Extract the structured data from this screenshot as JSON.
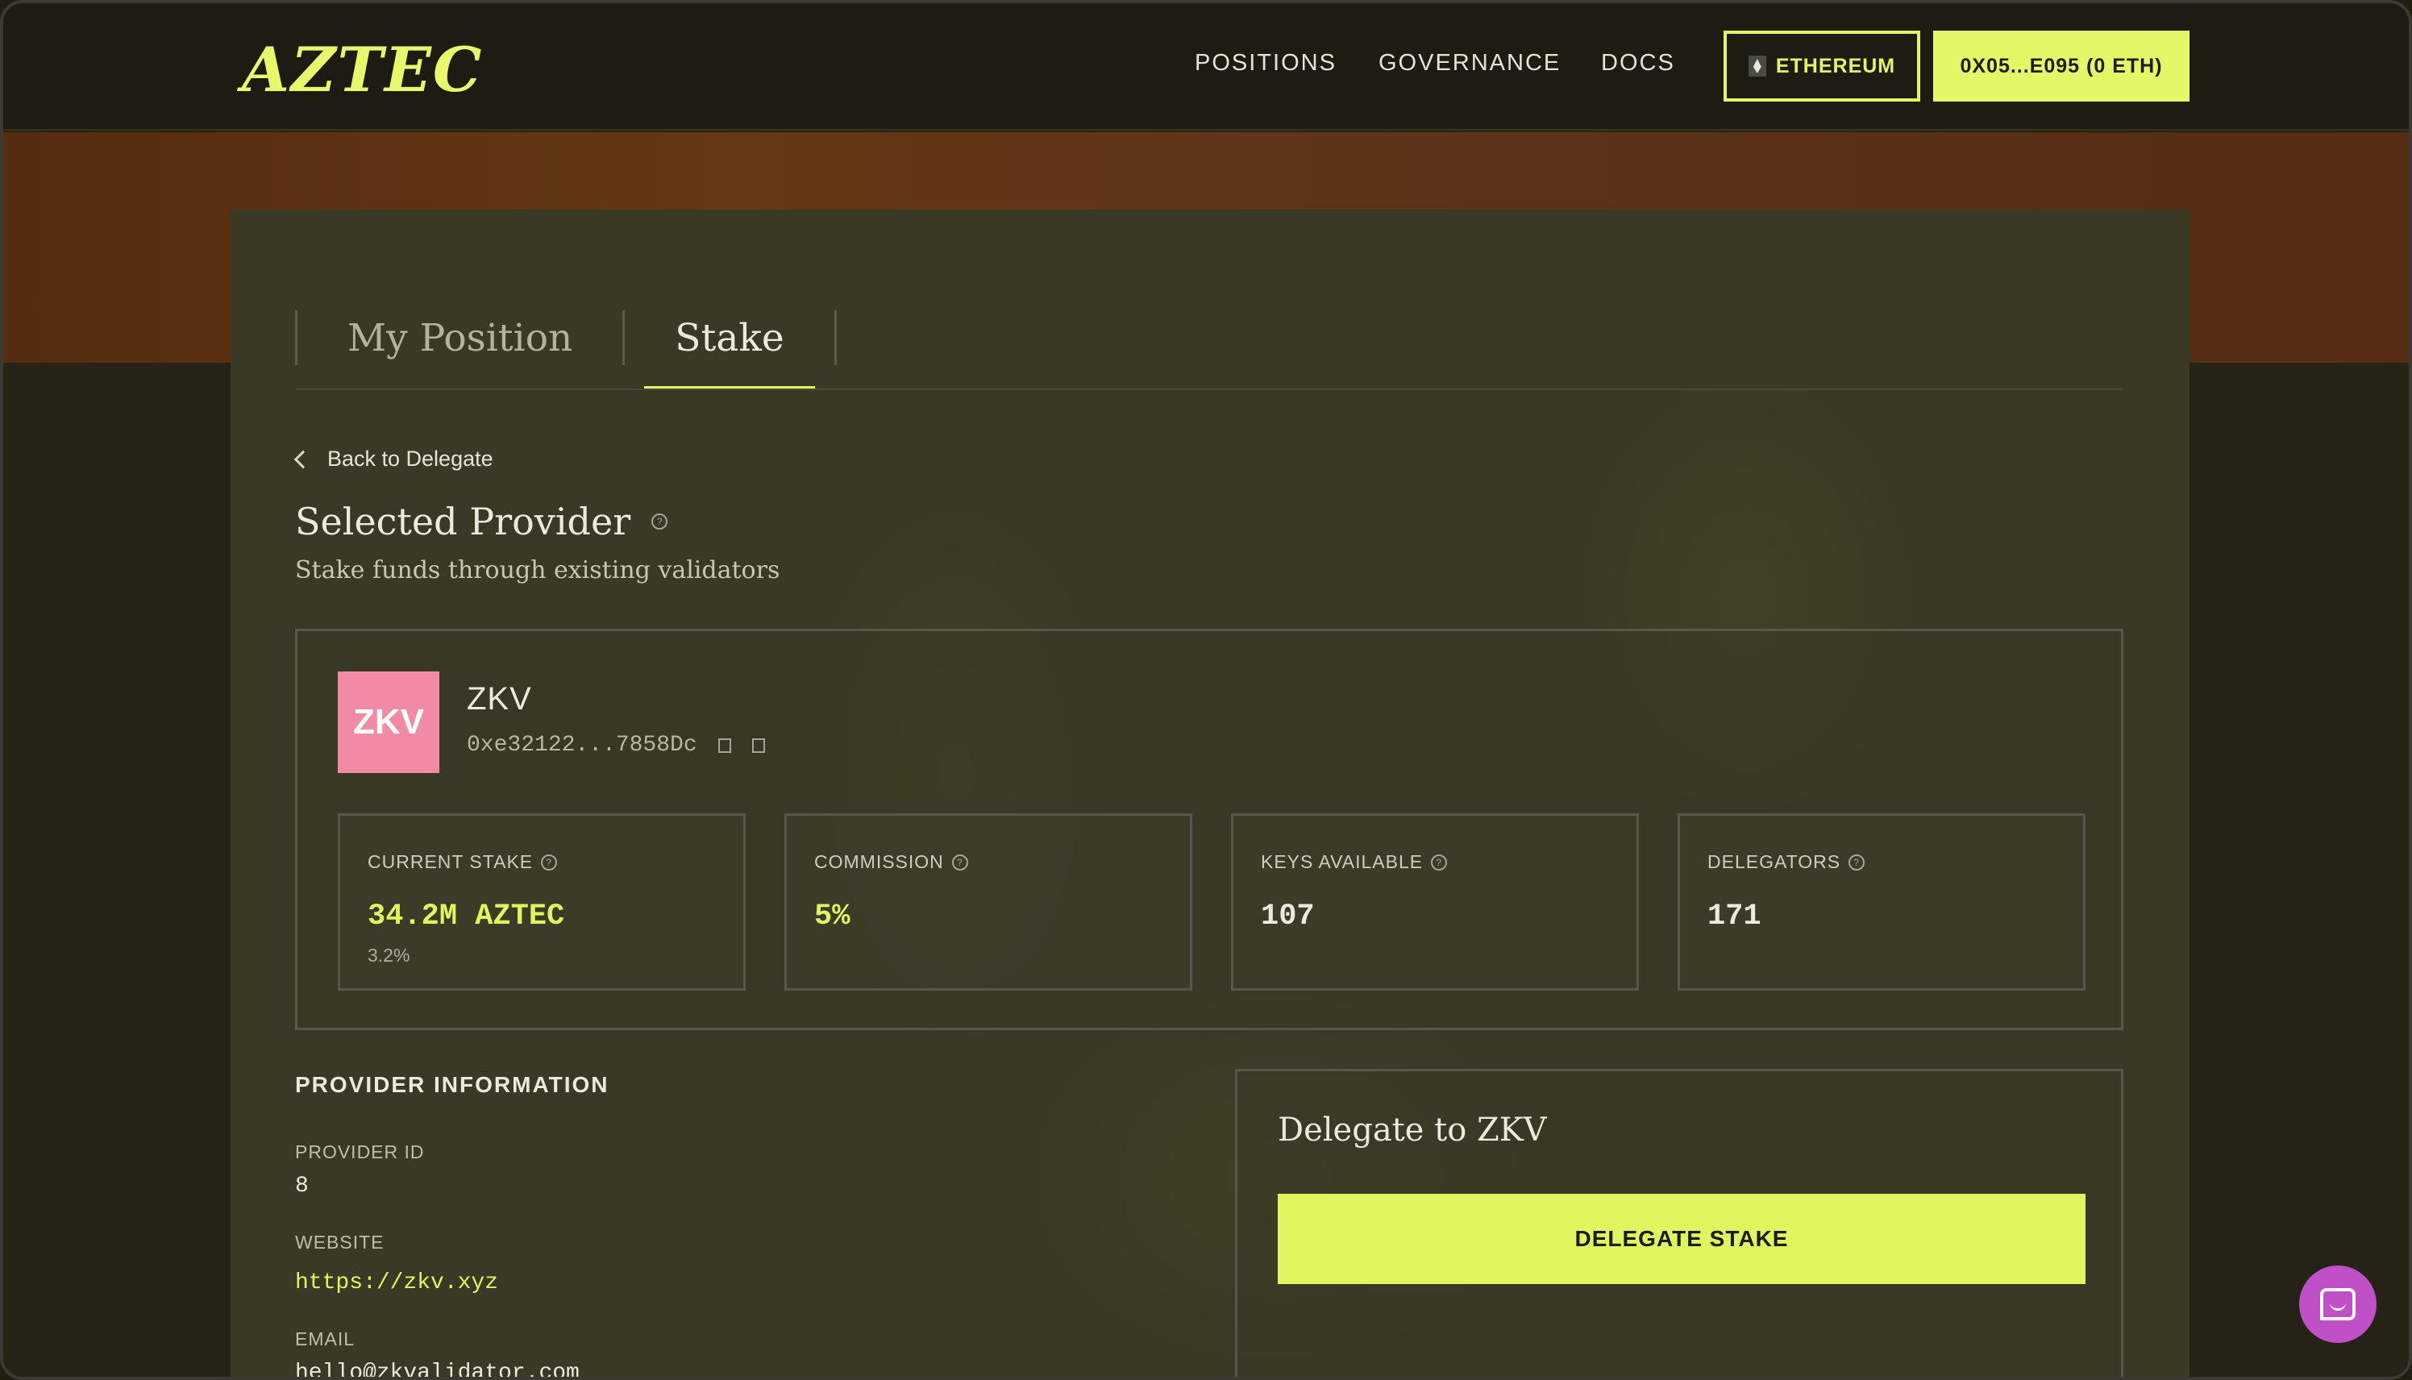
{
  "nav": {
    "logo": "AZTEC",
    "links": [
      "POSITIONS",
      "GOVERNANCE",
      "DOCS"
    ],
    "network_label": "ETHEREUM",
    "wallet_label": "0X05...E095 (0 ETH)"
  },
  "tabs": [
    "My Position",
    "Stake"
  ],
  "back_label": "Back to Delegate",
  "page": {
    "title": "Selected Provider",
    "subtitle": "Stake funds through existing validators"
  },
  "provider": {
    "logo_text": "ZKV",
    "name": "ZKV",
    "address": "0xe32122...7858Dc"
  },
  "stats": [
    {
      "label": "CURRENT STAKE",
      "value": "34.2M AZTEC",
      "sub": "3.2%",
      "accent": "lime"
    },
    {
      "label": "COMMISSION",
      "value": "5%",
      "sub": "",
      "accent": "lime"
    },
    {
      "label": "KEYS AVAILABLE",
      "value": "107",
      "sub": "",
      "accent": "white"
    },
    {
      "label": "DELEGATORS",
      "value": "171",
      "sub": "",
      "accent": "white"
    }
  ],
  "info": {
    "heading": "PROVIDER INFORMATION",
    "provider_id_label": "PROVIDER ID",
    "provider_id": "8",
    "website_label": "WEBSITE",
    "website": "https://zkv.xyz",
    "email_label": "EMAIL",
    "email": "hello@zkvalidator.com"
  },
  "delegate": {
    "title": "Delegate to ZKV",
    "button_label": "DELEGATE STAKE"
  },
  "colors": {
    "accent": "#e0f45e",
    "background": "#242315",
    "provider_logo": "#f08aa5",
    "chat": "#c050c8"
  }
}
